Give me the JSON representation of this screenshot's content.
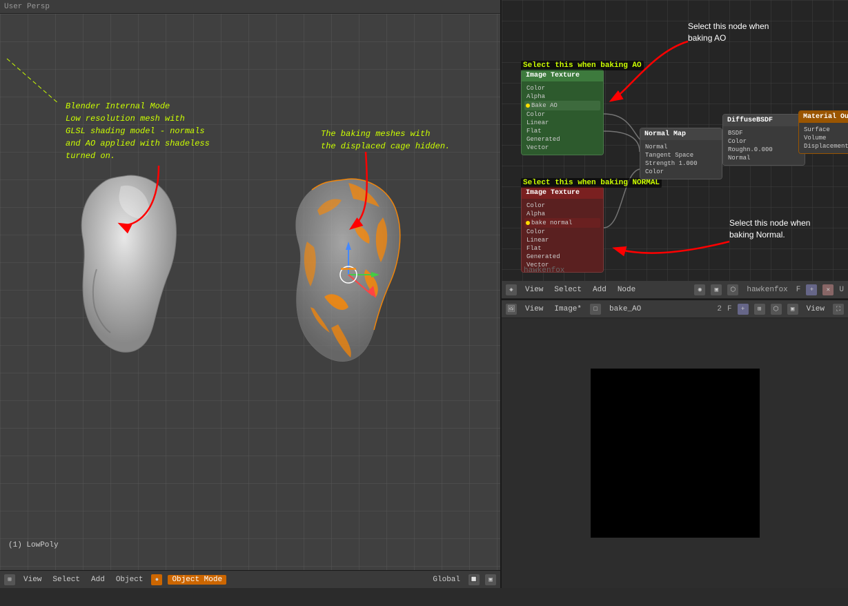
{
  "viewport": {
    "header": "User Persp",
    "annotation_blender": "Blender Internal Mode\nLow resolution mesh with\nGLSL shading model - normals\nand AO applied with shadeless\nturned on.",
    "annotation_baking": "The baking meshes with\nthe displaced cage hidden.",
    "status_bottom": "(1) LowPoly"
  },
  "left_toolbar": {
    "view": "View",
    "select": "Select",
    "add": "Add",
    "object": "Object",
    "mode": "Object Mode",
    "global": "Global"
  },
  "node_editor": {
    "view": "View",
    "select": "Select",
    "add": "Add",
    "node": "Node",
    "username": "hawkenfox",
    "node_label_ao": "Select this when baking AO",
    "node_label_normal": "Select this when baking NORMAL",
    "annotation_ao": "Select this node when\nbaking AO",
    "annotation_normal": "Select this node when\nbaking Normal.",
    "node_ao_header": "Image Texture",
    "node_ao_label": "Bake AO",
    "node_normal_header": "Image Texture",
    "node_normal_label": "bake normal",
    "node_normalmap_header": "Normal Map",
    "node_bsdf_header": "DiffuseBSDF",
    "node_output_header": "Material Output",
    "username_watermark": "hawkenfox"
  },
  "image_editor": {
    "view": "View",
    "image": "Image*",
    "bake_ao": "bake_AO",
    "f_value": "F",
    "toolbar_right": "2"
  },
  "bottom_left_bar": {
    "view": "View",
    "select": "Select",
    "add": "Add",
    "object": "Object",
    "mode": "Object Mode",
    "global": "Global"
  },
  "bottom_right_bar": {
    "view": "View",
    "image": "Image*",
    "bake_ao": "bake_AO",
    "number": "2"
  }
}
